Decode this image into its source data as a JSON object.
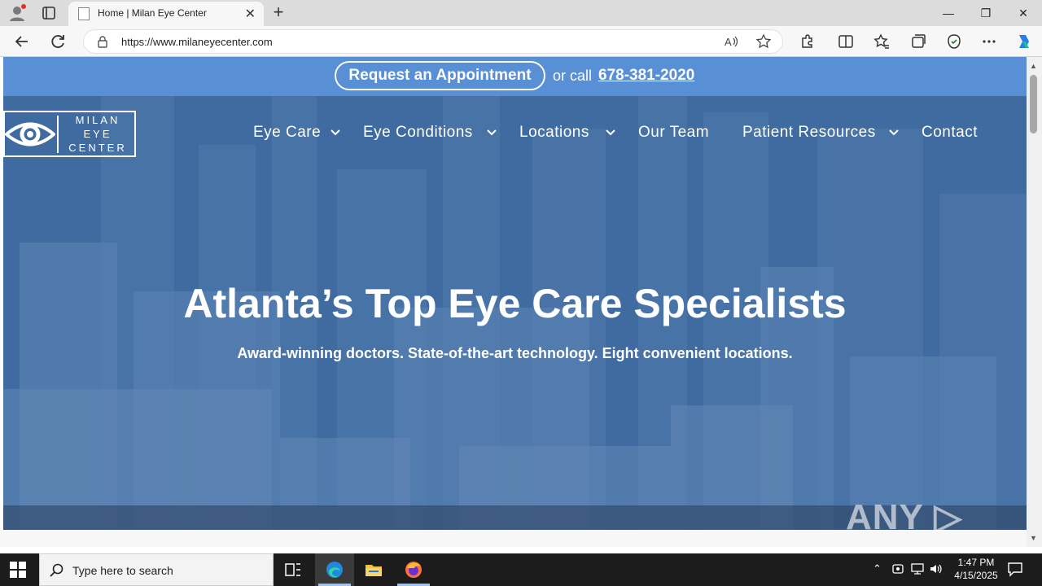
{
  "browser": {
    "tab_title": "Home | Milan Eye Center",
    "tab_close": "✕",
    "new_tab": "+",
    "url_host": "https://www.milaneyecenter.com",
    "window_controls": {
      "minimize": "—",
      "maximize": "❐",
      "close": "✕"
    }
  },
  "site": {
    "topbar": {
      "appointment_label": "Request an Appointment",
      "or_call": "or call",
      "phone": "678-381-2020"
    },
    "logo": {
      "line1": "MILAN",
      "line2": "EYE",
      "line3": "CENTER"
    },
    "menu": [
      {
        "label": "Eye Care",
        "has_dropdown": true
      },
      {
        "label": "Eye Conditions",
        "has_dropdown": true
      },
      {
        "label": "Locations",
        "has_dropdown": true
      },
      {
        "label": "Our Team",
        "has_dropdown": false
      },
      {
        "label": "Patient Resources",
        "has_dropdown": true
      },
      {
        "label": "Contact",
        "has_dropdown": false
      }
    ],
    "hero": {
      "title": "Atlanta’s Top Eye Care Specialists",
      "subtitle": "Award-winning doctors. State-of-the-art technology. Eight convenient locations."
    },
    "watermark": "ANY ▷ RUN"
  },
  "taskbar": {
    "search_placeholder": "Type here to search",
    "time": "1:47 PM",
    "date": "4/15/2025"
  },
  "colors": {
    "hero_blue": "#3e6ea8",
    "topbar_blue": "#5a90d6",
    "taskbar": "#1c1c1c"
  }
}
